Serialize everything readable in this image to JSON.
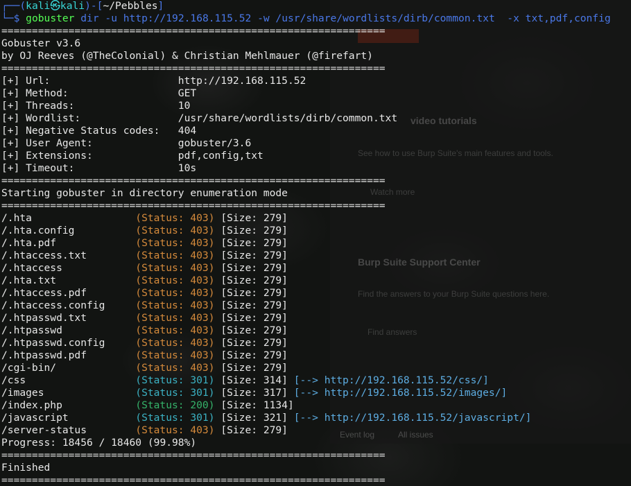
{
  "background_window": {
    "video_heading": "video tutorials",
    "video_text": "See how to use Burp Suite's main features and tools.",
    "watch_more": "Watch more",
    "support_heading": "Burp Suite Support Center",
    "support_text": "Find the answers to your Burp Suite questions here.",
    "find_answers": "Find answers",
    "tab_event_log": "Event log",
    "tab_all_issues": "All issues"
  },
  "prompt": {
    "line1_prefix": "┌──(",
    "user": "kali",
    "symbol": "㉿",
    "host": "kali",
    "line1_mid": ")-[",
    "path": "~/Pebbles",
    "line1_end": "]",
    "line2_prefix": "└─",
    "dollar": "$",
    "command": "gobuster",
    "args": "dir -u http://192.168.115.52 -w /usr/share/wordlists/dirb/common.txt  -x txt,pdf,config"
  },
  "separator": "===============================================================",
  "banner": {
    "version": "Gobuster v3.6",
    "authors": "by OJ Reeves (@TheColonial) & Christian Mehlmauer (@firefart)"
  },
  "config": [
    {
      "key": "[+] Url:",
      "value": "http://192.168.115.52"
    },
    {
      "key": "[+] Method:",
      "value": "GET"
    },
    {
      "key": "[+] Threads:",
      "value": "10"
    },
    {
      "key": "[+] Wordlist:",
      "value": "/usr/share/wordlists/dirb/common.txt"
    },
    {
      "key": "[+] Negative Status codes:",
      "value": "404"
    },
    {
      "key": "[+] User Agent:",
      "value": "gobuster/3.6"
    },
    {
      "key": "[+] Extensions:",
      "value": "pdf,config,txt"
    },
    {
      "key": "[+] Timeout:",
      "value": "10s"
    }
  ],
  "start_message": "Starting gobuster in directory enumeration mode",
  "results": [
    {
      "path": "/.hta",
      "status": "(Status: 403)",
      "size": "[Size: 279]",
      "code": "403",
      "redirect": ""
    },
    {
      "path": "/.hta.config",
      "status": "(Status: 403)",
      "size": "[Size: 279]",
      "code": "403",
      "redirect": ""
    },
    {
      "path": "/.hta.pdf",
      "status": "(Status: 403)",
      "size": "[Size: 279]",
      "code": "403",
      "redirect": ""
    },
    {
      "path": "/.htaccess.txt",
      "status": "(Status: 403)",
      "size": "[Size: 279]",
      "code": "403",
      "redirect": ""
    },
    {
      "path": "/.htaccess",
      "status": "(Status: 403)",
      "size": "[Size: 279]",
      "code": "403",
      "redirect": ""
    },
    {
      "path": "/.hta.txt",
      "status": "(Status: 403)",
      "size": "[Size: 279]",
      "code": "403",
      "redirect": ""
    },
    {
      "path": "/.htaccess.pdf",
      "status": "(Status: 403)",
      "size": "[Size: 279]",
      "code": "403",
      "redirect": ""
    },
    {
      "path": "/.htaccess.config",
      "status": "(Status: 403)",
      "size": "[Size: 279]",
      "code": "403",
      "redirect": ""
    },
    {
      "path": "/.htpasswd.txt",
      "status": "(Status: 403)",
      "size": "[Size: 279]",
      "code": "403",
      "redirect": ""
    },
    {
      "path": "/.htpasswd",
      "status": "(Status: 403)",
      "size": "[Size: 279]",
      "code": "403",
      "redirect": ""
    },
    {
      "path": "/.htpasswd.config",
      "status": "(Status: 403)",
      "size": "[Size: 279]",
      "code": "403",
      "redirect": ""
    },
    {
      "path": "/.htpasswd.pdf",
      "status": "(Status: 403)",
      "size": "[Size: 279]",
      "code": "403",
      "redirect": ""
    },
    {
      "path": "/cgi-bin/",
      "status": "(Status: 403)",
      "size": "[Size: 279]",
      "code": "403",
      "redirect": ""
    },
    {
      "path": "/css",
      "status": "(Status: 301)",
      "size": "[Size: 314]",
      "code": "301",
      "redirect": "[--> http://192.168.115.52/css/]"
    },
    {
      "path": "/images",
      "status": "(Status: 301)",
      "size": "[Size: 317]",
      "code": "301",
      "redirect": "[--> http://192.168.115.52/images/]"
    },
    {
      "path": "/index.php",
      "status": "(Status: 200)",
      "size": "[Size: 1134]",
      "code": "200",
      "redirect": ""
    },
    {
      "path": "/javascript",
      "status": "(Status: 301)",
      "size": "[Size: 321]",
      "code": "301",
      "redirect": "[--> http://192.168.115.52/javascript/]"
    },
    {
      "path": "/server-status",
      "status": "(Status: 403)",
      "size": "[Size: 279]",
      "code": "403",
      "redirect": ""
    }
  ],
  "progress": "Progress: 18456 / 18460 (99.98%)",
  "finished": "Finished",
  "colors": {
    "text_green": "#55ff55",
    "prompt_blue": "#4a78e8",
    "path_white": "#e8e8e8",
    "status_403": "#d58a3b",
    "status_301": "#3bb2c4",
    "status_200": "#35b36a",
    "redirect_link": "#5dade2"
  }
}
